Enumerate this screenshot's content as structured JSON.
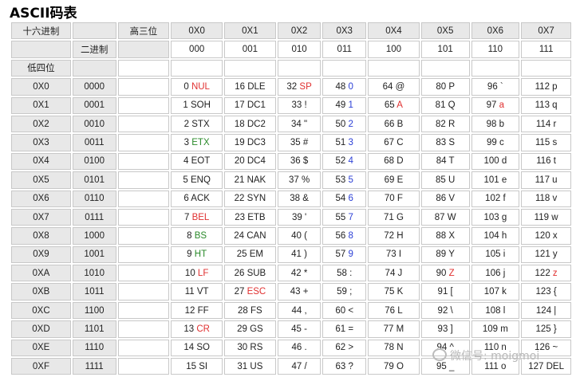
{
  "title": "ASCII码表",
  "header": {
    "hex_label": "十六进制",
    "high_label": "高三位",
    "bin_label": "二进制",
    "low_label": "低四位",
    "columns": [
      {
        "hex": "0X0",
        "bin": "000"
      },
      {
        "hex": "0X1",
        "bin": "001"
      },
      {
        "hex": "0X2",
        "bin": "010"
      },
      {
        "hex": "0X3",
        "bin": "011"
      },
      {
        "hex": "0X4",
        "bin": "100"
      },
      {
        "hex": "0X5",
        "bin": "101"
      },
      {
        "hex": "0X6",
        "bin": "110"
      },
      {
        "hex": "0X7",
        "bin": "111"
      }
    ]
  },
  "rows": [
    {
      "hex": "0X0",
      "bin": "0000",
      "cells": [
        [
          "0",
          "NUL",
          "red"
        ],
        [
          "16",
          "DLE",
          ""
        ],
        [
          "32",
          "SP",
          "red"
        ],
        [
          "48",
          "0",
          "blue"
        ],
        [
          "64",
          "@",
          ""
        ],
        [
          "80",
          "P",
          ""
        ],
        [
          "96",
          "`",
          ""
        ],
        [
          "112",
          "p",
          ""
        ]
      ]
    },
    {
      "hex": "0X1",
      "bin": "0001",
      "cells": [
        [
          "1",
          "SOH",
          ""
        ],
        [
          "17",
          "DC1",
          ""
        ],
        [
          "33",
          "!",
          ""
        ],
        [
          "49",
          "1",
          "blue"
        ],
        [
          "65",
          "A",
          "red"
        ],
        [
          "81",
          "Q",
          ""
        ],
        [
          "97",
          "a",
          "red"
        ],
        [
          "113",
          "q",
          ""
        ]
      ]
    },
    {
      "hex": "0X2",
      "bin": "0010",
      "cells": [
        [
          "2",
          "STX",
          ""
        ],
        [
          "18",
          "DC2",
          ""
        ],
        [
          "34",
          "\"",
          ""
        ],
        [
          "50",
          "2",
          "blue"
        ],
        [
          "66",
          "B",
          ""
        ],
        [
          "82",
          "R",
          ""
        ],
        [
          "98",
          "b",
          ""
        ],
        [
          "114",
          "r",
          ""
        ]
      ]
    },
    {
      "hex": "0X3",
      "bin": "0011",
      "cells": [
        [
          "3",
          "ETX",
          "green"
        ],
        [
          "19",
          "DC3",
          ""
        ],
        [
          "35",
          "#",
          ""
        ],
        [
          "51",
          "3",
          "blue"
        ],
        [
          "67",
          "C",
          ""
        ],
        [
          "83",
          "S",
          ""
        ],
        [
          "99",
          "c",
          ""
        ],
        [
          "115",
          "s",
          ""
        ]
      ]
    },
    {
      "hex": "0X4",
      "bin": "0100",
      "cells": [
        [
          "4",
          "EOT",
          ""
        ],
        [
          "20",
          "DC4",
          ""
        ],
        [
          "36",
          "$",
          ""
        ],
        [
          "52",
          "4",
          "blue"
        ],
        [
          "68",
          "D",
          ""
        ],
        [
          "84",
          "T",
          ""
        ],
        [
          "100",
          "d",
          ""
        ],
        [
          "116",
          "t",
          ""
        ]
      ]
    },
    {
      "hex": "0X5",
      "bin": "0101",
      "cells": [
        [
          "5",
          "ENQ",
          ""
        ],
        [
          "21",
          "NAK",
          ""
        ],
        [
          "37",
          "%",
          ""
        ],
        [
          "53",
          "5",
          "blue"
        ],
        [
          "69",
          "E",
          ""
        ],
        [
          "85",
          "U",
          ""
        ],
        [
          "101",
          "e",
          ""
        ],
        [
          "117",
          "u",
          ""
        ]
      ]
    },
    {
      "hex": "0X6",
      "bin": "0110",
      "cells": [
        [
          "6",
          "ACK",
          ""
        ],
        [
          "22",
          "SYN",
          ""
        ],
        [
          "38",
          "&",
          ""
        ],
        [
          "54",
          "6",
          "blue"
        ],
        [
          "70",
          "F",
          ""
        ],
        [
          "86",
          "V",
          ""
        ],
        [
          "102",
          "f",
          ""
        ],
        [
          "118",
          "v",
          ""
        ]
      ]
    },
    {
      "hex": "0X7",
      "bin": "0111",
      "cells": [
        [
          "7",
          "BEL",
          "red"
        ],
        [
          "23",
          "ETB",
          ""
        ],
        [
          "39",
          "'",
          ""
        ],
        [
          "55",
          "7",
          "blue"
        ],
        [
          "71",
          "G",
          ""
        ],
        [
          "87",
          "W",
          ""
        ],
        [
          "103",
          "g",
          ""
        ],
        [
          "119",
          "w",
          ""
        ]
      ]
    },
    {
      "hex": "0X8",
      "bin": "1000",
      "cells": [
        [
          "8",
          "BS",
          "green"
        ],
        [
          "24",
          "CAN",
          ""
        ],
        [
          "40",
          "(",
          ""
        ],
        [
          "56",
          "8",
          "blue"
        ],
        [
          "72",
          "H",
          ""
        ],
        [
          "88",
          "X",
          ""
        ],
        [
          "104",
          "h",
          ""
        ],
        [
          "120",
          "x",
          ""
        ]
      ]
    },
    {
      "hex": "0X9",
      "bin": "1001",
      "cells": [
        [
          "9",
          "HT",
          "green"
        ],
        [
          "25",
          "EM",
          ""
        ],
        [
          "41",
          ")",
          ""
        ],
        [
          "57",
          "9",
          "blue"
        ],
        [
          "73",
          "I",
          ""
        ],
        [
          "89",
          "Y",
          ""
        ],
        [
          "105",
          "i",
          ""
        ],
        [
          "121",
          "y",
          ""
        ]
      ]
    },
    {
      "hex": "0XA",
      "bin": "1010",
      "cells": [
        [
          "10",
          "LF",
          "red"
        ],
        [
          "26",
          "SUB",
          ""
        ],
        [
          "42",
          "*",
          ""
        ],
        [
          "58",
          ":",
          ""
        ],
        [
          "74",
          "J",
          ""
        ],
        [
          "90",
          "Z",
          "red"
        ],
        [
          "106",
          "j",
          ""
        ],
        [
          "122",
          "z",
          "red"
        ]
      ]
    },
    {
      "hex": "0XB",
      "bin": "1011",
      "cells": [
        [
          "11",
          "VT",
          ""
        ],
        [
          "27",
          "ESC",
          "red"
        ],
        [
          "43",
          "+",
          ""
        ],
        [
          "59",
          ";",
          ""
        ],
        [
          "75",
          "K",
          ""
        ],
        [
          "91",
          "[",
          ""
        ],
        [
          "107",
          "k",
          ""
        ],
        [
          "123",
          "{",
          ""
        ]
      ]
    },
    {
      "hex": "0XC",
      "bin": "1100",
      "cells": [
        [
          "12",
          "FF",
          ""
        ],
        [
          "28",
          "FS",
          ""
        ],
        [
          "44",
          ",",
          ""
        ],
        [
          "60",
          "<",
          ""
        ],
        [
          "76",
          "L",
          ""
        ],
        [
          "92",
          "\\",
          ""
        ],
        [
          "108",
          "l",
          ""
        ],
        [
          "124",
          "|",
          ""
        ]
      ]
    },
    {
      "hex": "0XD",
      "bin": "1101",
      "cells": [
        [
          "13",
          "CR",
          "red"
        ],
        [
          "29",
          "GS",
          ""
        ],
        [
          "45",
          "-",
          ""
        ],
        [
          "61",
          "=",
          ""
        ],
        [
          "77",
          "M",
          ""
        ],
        [
          "93",
          "]",
          ""
        ],
        [
          "109",
          "m",
          ""
        ],
        [
          "125",
          "}",
          ""
        ]
      ]
    },
    {
      "hex": "0XE",
      "bin": "1110",
      "cells": [
        [
          "14",
          "SO",
          ""
        ],
        [
          "30",
          "RS",
          ""
        ],
        [
          "46",
          ".",
          ""
        ],
        [
          "62",
          ">",
          ""
        ],
        [
          "78",
          "N",
          ""
        ],
        [
          "94",
          "^",
          ""
        ],
        [
          "110",
          "n",
          ""
        ],
        [
          "126",
          "~",
          ""
        ]
      ]
    },
    {
      "hex": "0XF",
      "bin": "1111",
      "cells": [
        [
          "15",
          "SI",
          ""
        ],
        [
          "31",
          "US",
          ""
        ],
        [
          "47",
          "/",
          ""
        ],
        [
          "63",
          "?",
          ""
        ],
        [
          "79",
          "O",
          ""
        ],
        [
          "95",
          "_",
          ""
        ],
        [
          "111",
          "o",
          ""
        ],
        [
          "127",
          "DEL",
          ""
        ]
      ]
    }
  ],
  "watermark": "微信号: moigmoi"
}
